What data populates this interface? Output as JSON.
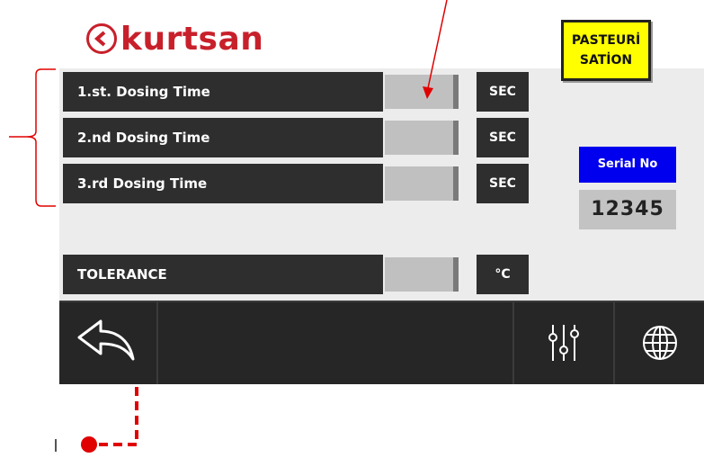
{
  "brand": {
    "name": "kurtsan",
    "color": "#c8202b"
  },
  "mode_button": {
    "line1": "PASTEURİ",
    "line2": "SATİON",
    "color": "#ffff00"
  },
  "params": [
    {
      "label": "1.st. Dosing Time",
      "value": "",
      "unit": "SEC"
    },
    {
      "label": "2.nd Dosing Time",
      "value": "",
      "unit": "SEC"
    },
    {
      "label": "3.rd Dosing Time",
      "value": "",
      "unit": "SEC"
    },
    {
      "label": "TOLERANCE",
      "value": "",
      "unit": "°C"
    }
  ],
  "serial": {
    "label": "Serial No",
    "value": "12345",
    "label_color": "#0000ee"
  },
  "footer": {
    "back_icon": "back-arrow-icon",
    "settings_icon": "sliders-icon",
    "language_icon": "globe-icon"
  },
  "annotation_color": "#e00000"
}
